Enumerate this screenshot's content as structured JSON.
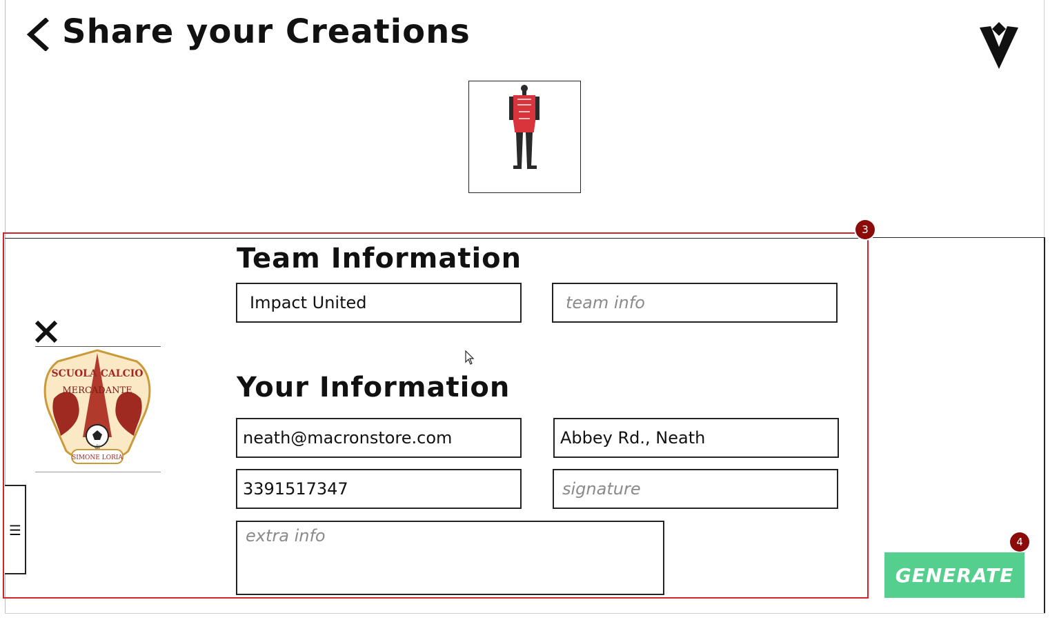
{
  "header": {
    "title": "Share your Creations"
  },
  "team_section": {
    "title": "Team Information",
    "team_name": {
      "value": "Impact United",
      "placeholder": ""
    },
    "team_info": {
      "value": "",
      "placeholder": "team info"
    }
  },
  "your_section": {
    "title": "Your Information",
    "email": {
      "value": "neath@macronstore.com",
      "placeholder": ""
    },
    "address": {
      "value": "Abbey Rd., Neath",
      "placeholder": ""
    },
    "phone": {
      "value": "3391517347",
      "placeholder": ""
    },
    "signature": {
      "value": "",
      "placeholder": "signature"
    },
    "extra_info": {
      "value": "",
      "placeholder": "extra info"
    }
  },
  "crest": {
    "line1": "SCUOLA CALCIO",
    "line2": "MERCADANTE",
    "line3": "di",
    "line4": "SIMONE LORIA"
  },
  "side_tab": {
    "glyph": "☰"
  },
  "badges": {
    "form_step": "3",
    "generate_step": "4"
  },
  "actions": {
    "generate_label": "GENERATE"
  },
  "icons": {
    "back": "chevron-left-icon",
    "brand": "macron-logo-icon",
    "close": "close-icon",
    "menu": "menu-icon"
  },
  "colors": {
    "highlight_border": "#d2232a",
    "badge": "#8b0a0a",
    "generate": "#54cf8d",
    "kit_red": "#d9343b"
  }
}
